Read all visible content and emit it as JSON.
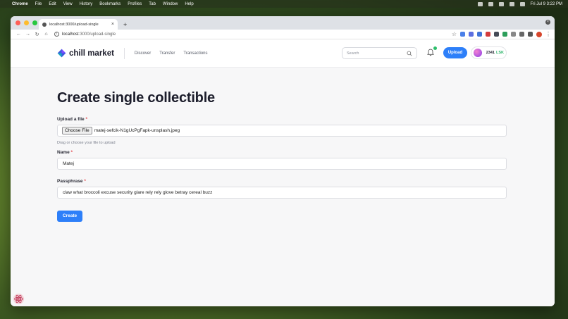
{
  "macos_menu_bar": {
    "app": "Chrome",
    "menus": [
      "File",
      "Edit",
      "View",
      "History",
      "Bookmarks",
      "Profiles",
      "Tab",
      "Window",
      "Help"
    ],
    "clock": "Fri Jul 9  3:22 PM"
  },
  "browser": {
    "tab_title": "localhost:3000/upload-single",
    "tab_close": "×",
    "new_tab": "+",
    "window_close": "×",
    "url_host": "localhost",
    "url_path": ":3000/upload-single",
    "url_info": "i",
    "nav": {
      "back": "←",
      "forward": "→",
      "reload": "↻",
      "home": "⌂"
    },
    "bookmark_star": "☆",
    "menu": "⋮",
    "extension_colors": [
      "#4a7fe8",
      "#5b6ee0",
      "#3f72d6",
      "#d33b3b",
      "#444a55",
      "#2c9e5a",
      "#888",
      "#666",
      "#555"
    ]
  },
  "header": {
    "logo_text": "chill market",
    "nav": [
      "Discover",
      "Transfer",
      "Transactions"
    ],
    "search_placeholder": "Search",
    "upload_label": "Upload",
    "wallet_amount": "2341",
    "wallet_unit": "LSK",
    "colors": {
      "accent": "#2d7ff9",
      "notification": "#2cbe6a",
      "token": "#2cb46a"
    }
  },
  "form": {
    "title": "Create single collectible",
    "file_label": "Upload a file",
    "required_mark": "*",
    "choose_file_label": "Choose File",
    "file_name": "matej-sefcik-N1gUcPgFapk-unsplash.jpeg",
    "file_helper": "Drag or choose your file to upload",
    "name_label": "Name",
    "name_value": "Matej",
    "passphrase_label": "Passphrase",
    "passphrase_value": "claw what broccoli excuse security glare rely rely glove betray cereal buzz",
    "create_label": "Create"
  }
}
